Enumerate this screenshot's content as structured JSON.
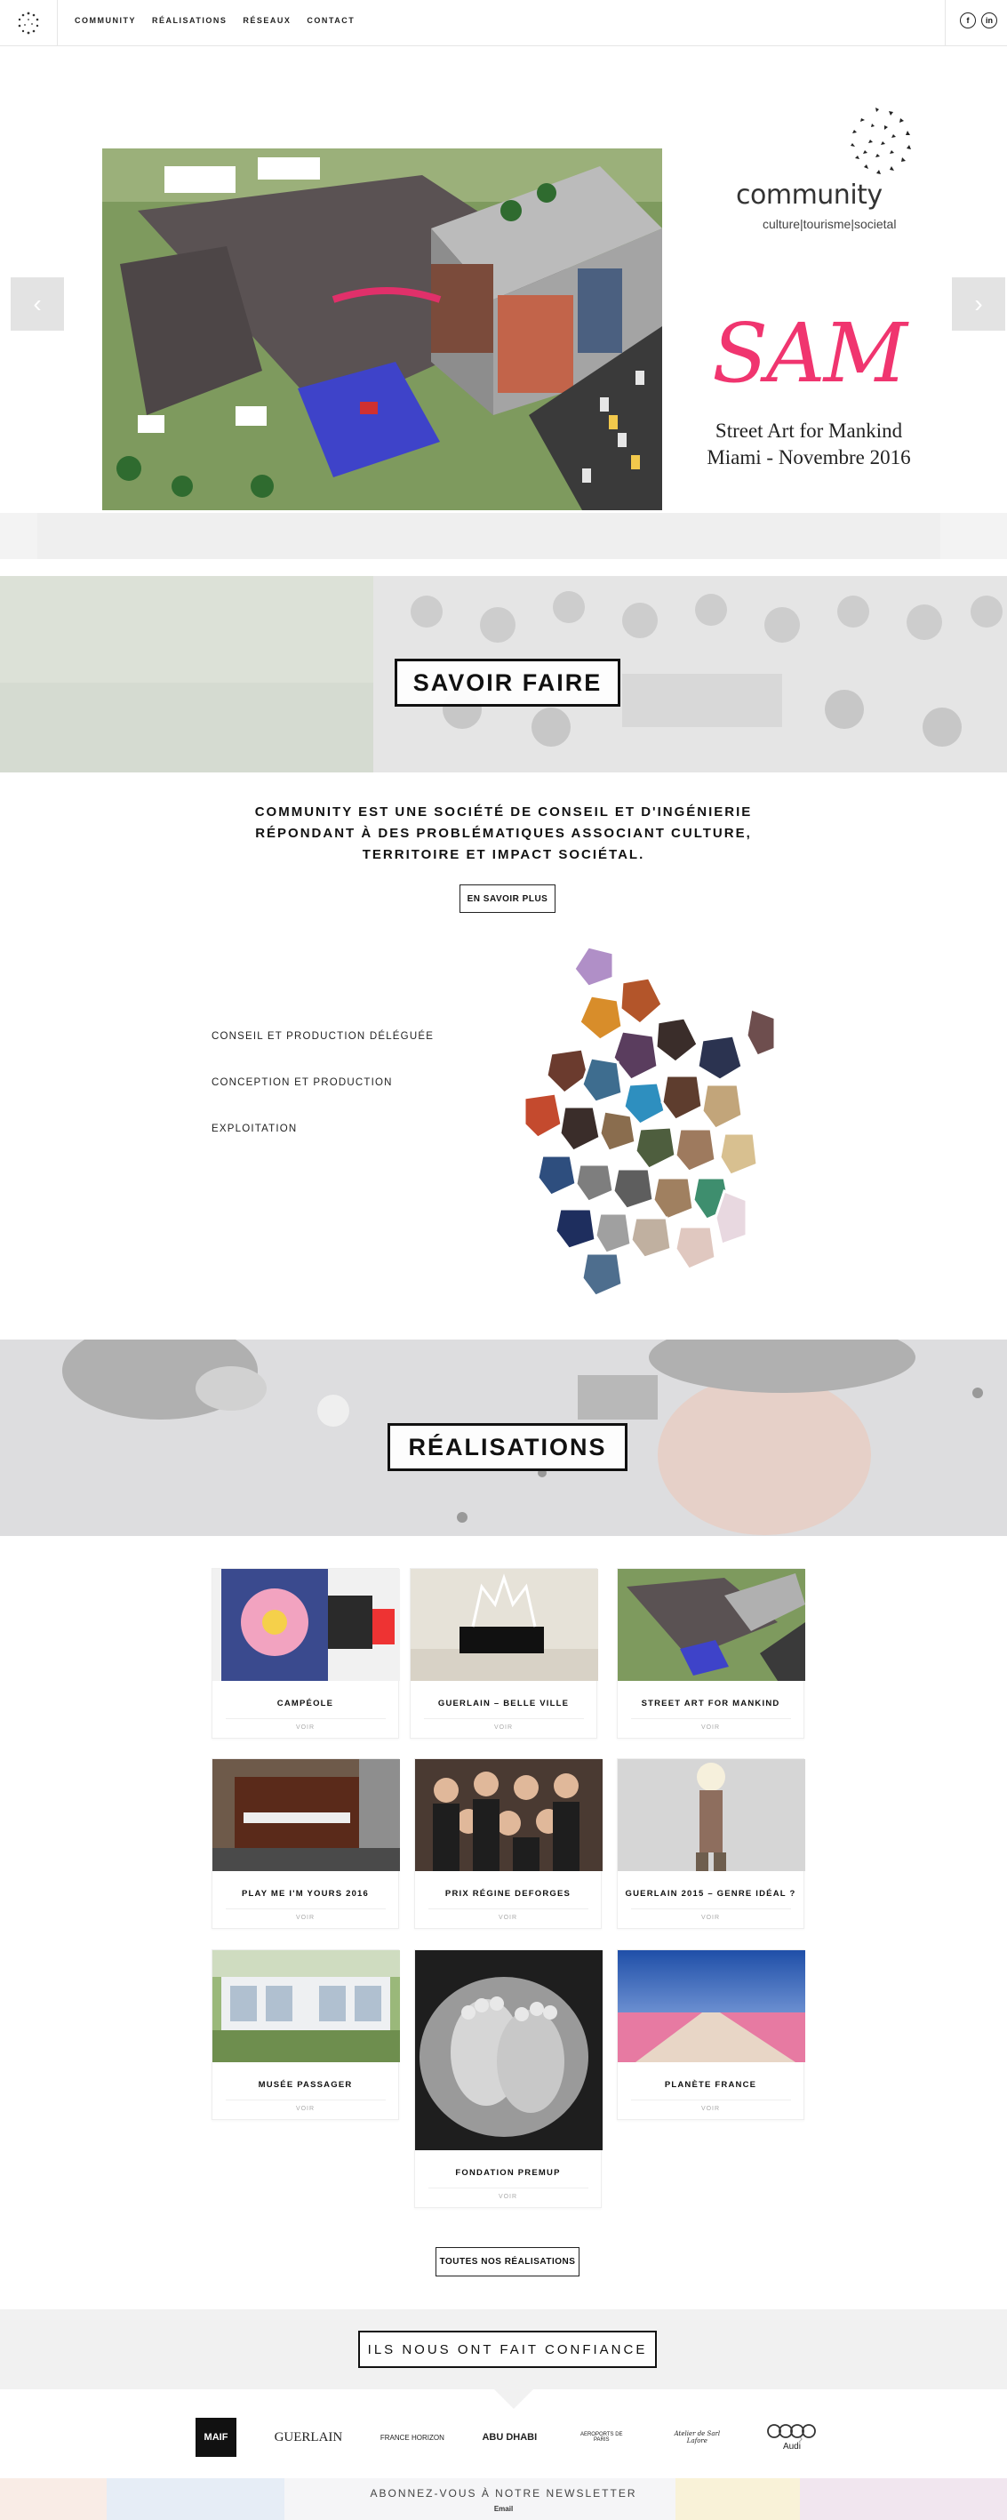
{
  "nav": {
    "items": [
      "COMMUNITY",
      "RÉALISATIONS",
      "RÉSEAUX",
      "CONTACT"
    ],
    "social": [
      "f",
      "in"
    ]
  },
  "hero": {
    "brand_word": "community",
    "brand_tagline": "culture|tourisme|societal",
    "slide_title": "SAM",
    "slide_line1": "Street Art for Mankind",
    "slide_line2": "Miami - Novembre 2016",
    "prev_label": "‹",
    "next_label": "›"
  },
  "savoir_faire": {
    "heading": "SAVOIR FAIRE",
    "intro": "COMMUNITY EST UNE SOCIÉTÉ DE CONSEIL ET D'INGÉNIERIE RÉPONDANT À DES PROBLÉMATIQUES ASSOCIANT CULTURE, TERRITOIRE ET IMPACT SOCIÉTAL.",
    "button": "EN SAVOIR PLUS",
    "services": [
      "CONSEIL ET PRODUCTION DÉLÉGUÉE",
      "CONCEPTION ET PRODUCTION",
      "EXPLOITATION"
    ]
  },
  "realisations": {
    "heading": "RÉALISATIONS",
    "voir_label": "VOIR",
    "cards": [
      {
        "title": "CAMPÉOLE"
      },
      {
        "title": "GUERLAIN – BELLE VILLE"
      },
      {
        "title": "STREET ART FOR MANKIND"
      },
      {
        "title": "PLAY ME I'M YOURS 2016"
      },
      {
        "title": "PRIX RÉGINE DEFORGES"
      },
      {
        "title": "GUERLAIN 2015 – GENRE IDÉAL ?"
      },
      {
        "title": "MUSÉE PASSAGER"
      },
      {
        "title": "FONDATION PREMUP"
      },
      {
        "title": "PLANÈTE FRANCE"
      }
    ],
    "all_button": "TOUTES NOS RÉALISATIONS"
  },
  "trust": {
    "heading": "ILS NOUS ONT FAIT CONFIANCE",
    "logos": [
      "MAIF",
      "GUERLAIN",
      "FRANCE HORIZON",
      "ABU DHABI",
      "AEROPORTS DE PARIS",
      "Atelier de Sarl Lafore",
      "Audi"
    ]
  },
  "newsletter": {
    "label": "ABONNEZ-VOUS À NOTRE NEWSLETTER",
    "email_label": "Email"
  },
  "colors": {
    "accent_pink": "#f0356f",
    "dark": "#111111",
    "light_band": "#f1f1f1"
  }
}
